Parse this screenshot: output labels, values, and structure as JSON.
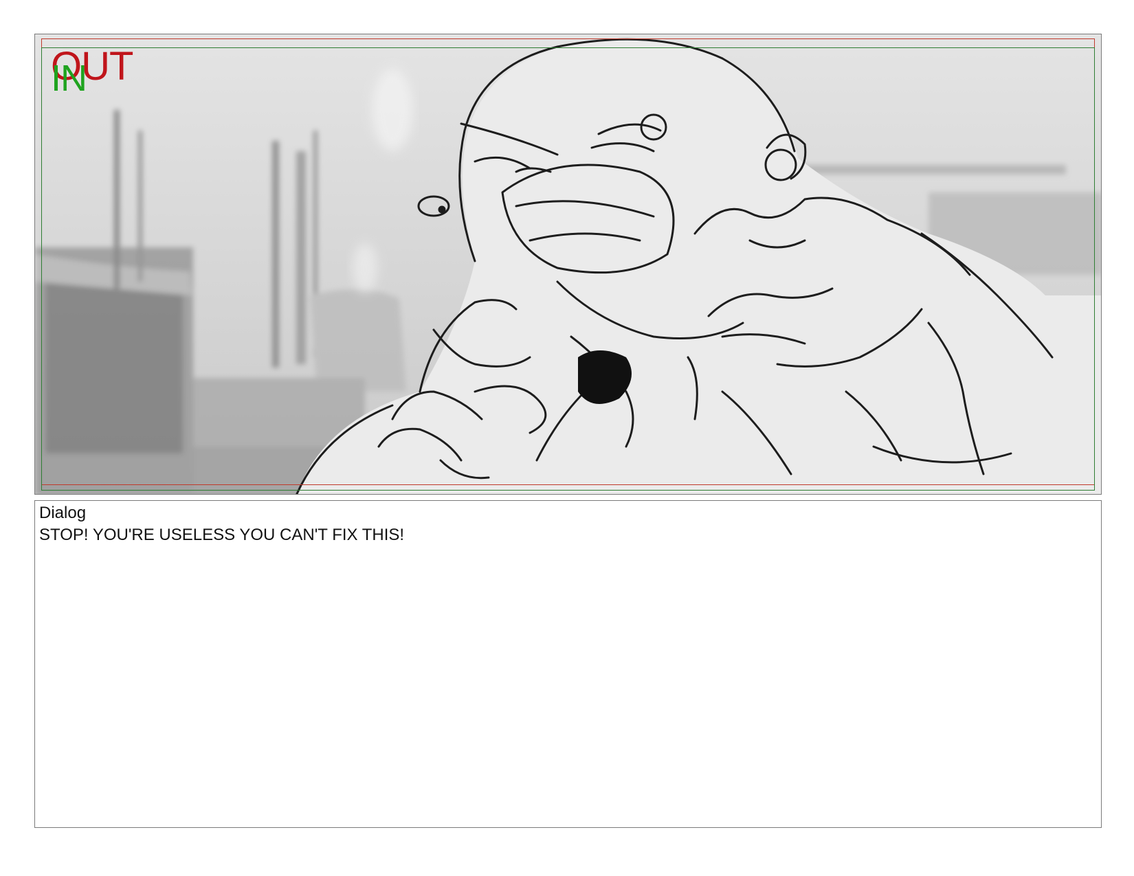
{
  "panel": {
    "out_label": "OUT",
    "in_label": "IN",
    "colors": {
      "out_guide": "#c0392b",
      "in_guide": "#2e7d32",
      "sketch_background": "#d6d6d6"
    }
  },
  "dialog": {
    "heading": "Dialog",
    "text": "STOP! YOU'RE USELESS YOU CAN'T FIX THIS!"
  }
}
